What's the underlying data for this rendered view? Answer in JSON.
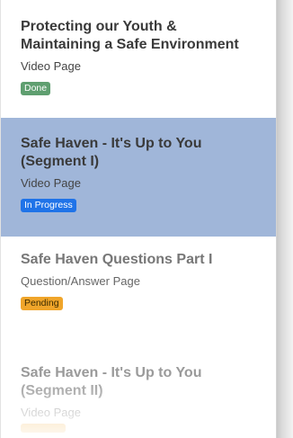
{
  "modules": [
    {
      "title_line1": "Protecting our Youth &",
      "title_line2": "Maintaining a Safe Environment",
      "type": "Video Page",
      "status": "Done",
      "status_color": "#5f9f70"
    },
    {
      "title_line1": "Safe Haven - It's Up to You",
      "title_line2": "(Segment I)",
      "type": "Video Page",
      "status": "In Progress",
      "status_color": "#1f73e8",
      "selected": true,
      "selected_color": "#a0b6d9"
    },
    {
      "title_line1": "Safe Haven Questions Part I",
      "type": "Question/Answer Page",
      "status": "Pending",
      "status_color": "#f0a52a"
    },
    {
      "title_line1": "Safe Haven - It's Up to You",
      "title_line2": "(Segment II)",
      "type": "Video Page",
      "status": "",
      "status_color": "#f0a52a"
    }
  ]
}
